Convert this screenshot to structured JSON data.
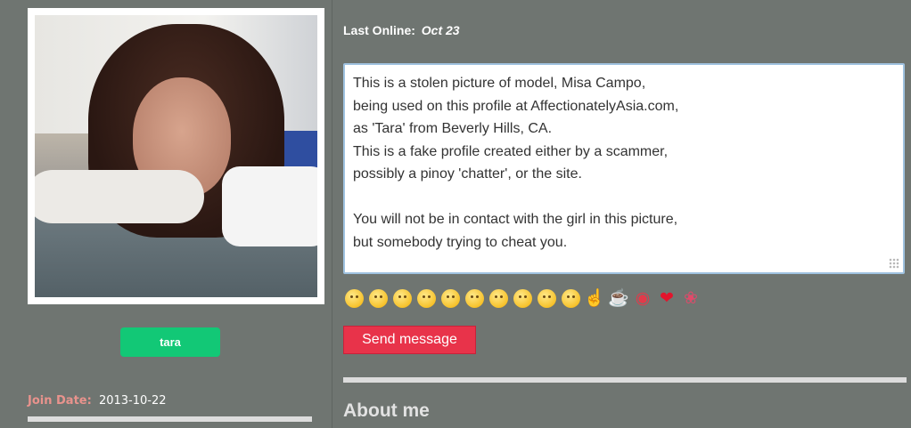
{
  "profile": {
    "name": "tara",
    "join_label": "Join Date:",
    "join_date": "2013-10-22"
  },
  "status": {
    "last_online_label": "Last Online:",
    "last_online_value": "Oct 23"
  },
  "message": {
    "lines": [
      "This is a stolen picture of model, Misa Campo,",
      "being used on this profile at AffectionatelyAsia.com,",
      "as 'Tara' from Beverly Hills, CA.",
      "This is a fake profile created either by a scammer,",
      "possibly a pinoy 'chatter', or the site.",
      "",
      "You will not be in contact with the girl in this picture,",
      "but somebody trying to cheat you."
    ]
  },
  "emojis": [
    "smile-emoji",
    "blush-emoji",
    "grimace-emoji",
    "surprised-emoji",
    "neutral-emoji",
    "frown-emoji",
    "tired-emoji",
    "laughing-emoji",
    "tongue-emoji",
    "sad-emoji",
    "thumb-emoji",
    "drink-emoji",
    "lips-emoji",
    "heart-emoji",
    "rose-emoji"
  ],
  "actions": {
    "send_label": "Send message"
  },
  "sections": {
    "about_title": "About me"
  },
  "colors": {
    "background": "#6f7571",
    "name_badge": "#12c876",
    "send_button": "#e8334a",
    "join_label": "#e9938d"
  }
}
